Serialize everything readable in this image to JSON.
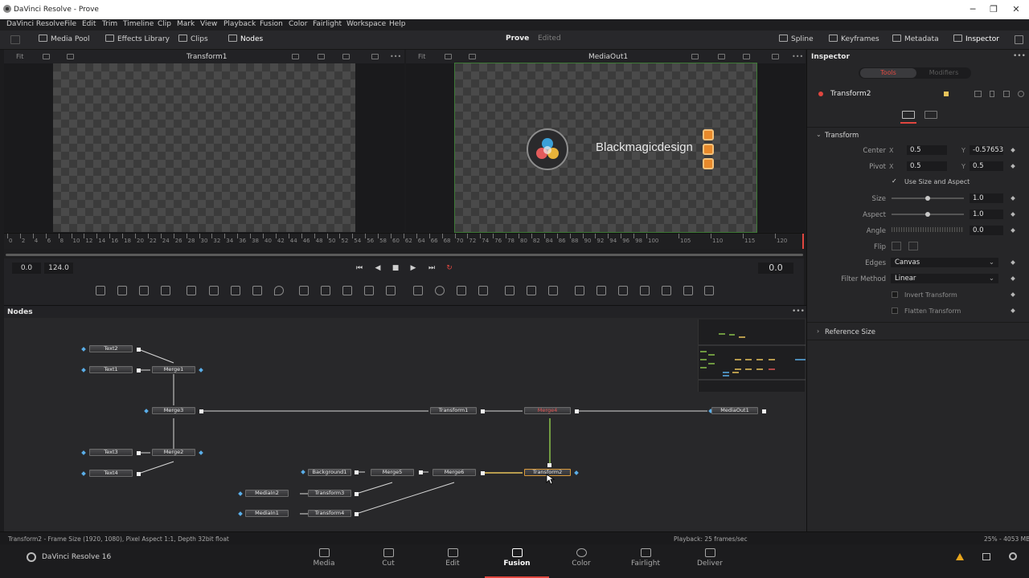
{
  "window": {
    "title": "DaVinci Resolve - Prove",
    "minimize": "─",
    "maximize": "❐",
    "close": "✕"
  },
  "menu": [
    "DaVinci Resolve",
    "File",
    "Edit",
    "Trim",
    "Timeline",
    "Clip",
    "Mark",
    "View",
    "Playback",
    "Fusion",
    "Color",
    "Fairlight",
    "Workspace",
    "Help"
  ],
  "toolbar": {
    "media_pool": "Media Pool",
    "effects_library": "Effects Library",
    "clips": "Clips",
    "nodes": "Nodes",
    "project": "Prove",
    "project_status": "Edited",
    "spline": "Spline",
    "keyframes": "Keyframes",
    "metadata": "Metadata",
    "inspector": "Inspector"
  },
  "viewer_left": {
    "fit": "Fit",
    "title": "Transform1"
  },
  "viewer_right": {
    "fit": "Fit",
    "title": "MediaOut1",
    "logo_text": "Blackmagicdesign"
  },
  "ruler": {
    "labels": [
      "0",
      "2",
      "4",
      "6",
      "8",
      "10",
      "12",
      "14",
      "16",
      "18",
      "20",
      "22",
      "24",
      "26",
      "28",
      "30",
      "32",
      "34",
      "36",
      "38",
      "40",
      "42",
      "44",
      "46",
      "48",
      "50",
      "52",
      "54",
      "56",
      "58",
      "60",
      "62",
      "64",
      "66",
      "68",
      "70",
      "72",
      "74",
      "76",
      "78",
      "80",
      "82",
      "84",
      "86",
      "88",
      "90",
      "92",
      "94",
      "96",
      "98",
      "100",
      "105",
      "110",
      "115",
      "120"
    ]
  },
  "transport": {
    "start": "0.0",
    "end": "124.0",
    "current": "0.0",
    "first": "⏮",
    "prev": "◀",
    "stop": "■",
    "play": "▶",
    "last": "⏭",
    "loop": "↻"
  },
  "nodes_panel": {
    "title": "Nodes",
    "menu": "•••"
  },
  "nodes": {
    "text2": "Text2",
    "text1": "Text1",
    "merge1": "Merge1",
    "merge3": "Merge3",
    "text3": "Text3",
    "merge2": "Merge2",
    "text4": "Text4",
    "transform1": "Transform1",
    "merge4": "Merge4",
    "mediaout1": "MediaOut1",
    "background1": "Background1",
    "merge5": "Merge5",
    "merge6": "Merge6",
    "transform2": "Transform2",
    "mediain2": "MediaIn2",
    "transform3": "Transform3",
    "mediain1": "MediaIn1",
    "transform4": "Transform4"
  },
  "status": {
    "left": "Transform2 - Frame Size (1920, 1080), Pixel Aspect 1:1, Depth 32bit float",
    "center": "Playback: 25 frames/sec",
    "right": "25% - 4053 MB"
  },
  "pages": {
    "app": "DaVinci Resolve 16",
    "media": "Media",
    "cut": "Cut",
    "edit": "Edit",
    "fusion": "Fusion",
    "color": "Color",
    "fairlight": "Fairlight",
    "deliver": "Deliver"
  },
  "inspector": {
    "title": "Inspector",
    "tab_tools": "Tools",
    "tab_modifiers": "Modifiers",
    "node_name": "Transform2",
    "section": "Transform",
    "center_label": "Center",
    "center_x_lbl": "X",
    "center_x": "0.5",
    "center_y_lbl": "Y",
    "center_y": "-0.57653",
    "pivot_label": "Pivot",
    "pivot_x_lbl": "X",
    "pivot_x": "0.5",
    "pivot_y_lbl": "Y",
    "pivot_y": "0.5",
    "use_size": "Use Size and Aspect",
    "size_label": "Size",
    "size": "1.0",
    "aspect_label": "Aspect",
    "aspect": "1.0",
    "angle_label": "Angle",
    "angle": "0.0",
    "flip_label": "Flip",
    "edges_label": "Edges",
    "edges": "Canvas",
    "filter_label": "Filter Method",
    "filter": "Linear",
    "invert": "Invert Transform",
    "flatten": "Flatten Transform",
    "reference": "Reference Size"
  }
}
